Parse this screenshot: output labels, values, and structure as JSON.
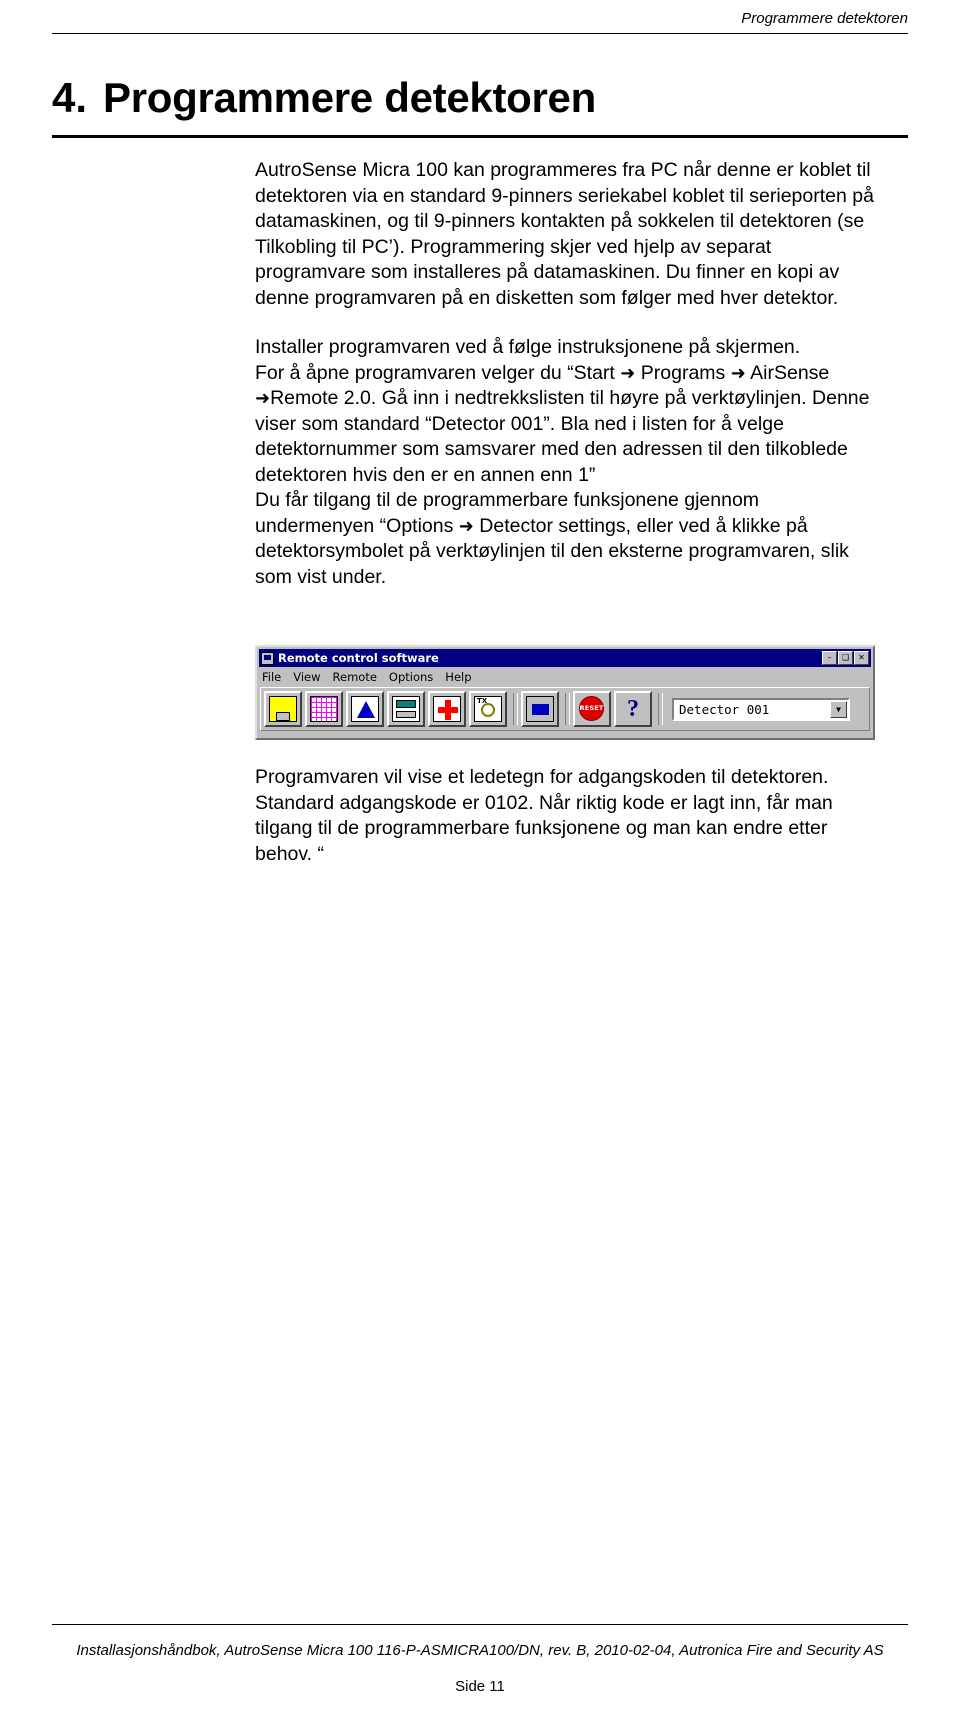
{
  "header": {
    "running_head": "Programmere detektoren"
  },
  "title": {
    "number": "4.",
    "text": "Programmere detektoren"
  },
  "body": {
    "p1": "AutroSense Micra 100 kan programmeres fra PC når denne er koblet til detektoren via en standard 9-pinners seriekabel koblet til serieporten på datamaskinen, og til 9-pinners kontakten på sokkelen til detektoren (se Tilkobling til PC’). Programmering skjer ved hjelp av separat programvare som installeres på datamaskinen. Du finner en kopi av denne programvaren på en disketten som følger med hver detektor.",
    "p2_line1": "Installer programvaren ved å følge instruksjonene på skjermen.",
    "p2_line2a": "For å åpne programvaren velger du “Start ",
    "p2_line2b": " Programs ",
    "p2_line2c": " AirSense ",
    "p2_line3a": "Remote 2.0",
    "p2_line3b": ". Gå inn i nedtrekkslisten til høyre på verktøylinjen.",
    "p2_line4": "Denne viser som standard “Detector 001”. Bla ned i listen for å velge detektornummer som samsvarer med den adressen til den tilkoblede detektoren hvis den er en annen enn 1”",
    "p2_line5a": "Du får tilgang til de programmerbare funksjonene gjennom undermenyen “Options ",
    "p2_line5b": " Detector settings, eller ved å klikke på detektorsymbolet på verktøylinjen til den eksterne programvaren, slik som vist under.",
    "p3": "Programvaren vil vise et ledetegn for adgangskoden til detektoren. Standard adgangskode er 0102. Når riktig kode er lagt inn, får man tilgang til de programmerbare funksjonene og man kan endre etter behov. “",
    "arrow_glyph": "➜"
  },
  "app_window": {
    "title": "Remote control software",
    "window_buttons": [
      "–",
      "❑",
      "✕"
    ],
    "menu": [
      "File",
      "View",
      "Remote",
      "Options",
      "Help"
    ],
    "toolbar_icons": [
      "disk-save-icon",
      "grid-chart-icon",
      "signal-waveform-icon",
      "detector-settings-icon",
      "add-detector-icon",
      "tx-search-icon",
      "blue-panel-icon",
      "reset-icon",
      "help-icon"
    ],
    "reset_label": "RESET",
    "tx_label": "TX",
    "help_label": "?",
    "detector_combo_value": "Detector 001",
    "combo_arrow_glyph": "▼"
  },
  "footer": {
    "text": "Installasjonshåndbok, AutroSense Micra 100 116-P-ASMICRA100/DN, rev. B, 2010-02-04, Autronica Fire and Security AS",
    "page": "Side 11"
  }
}
